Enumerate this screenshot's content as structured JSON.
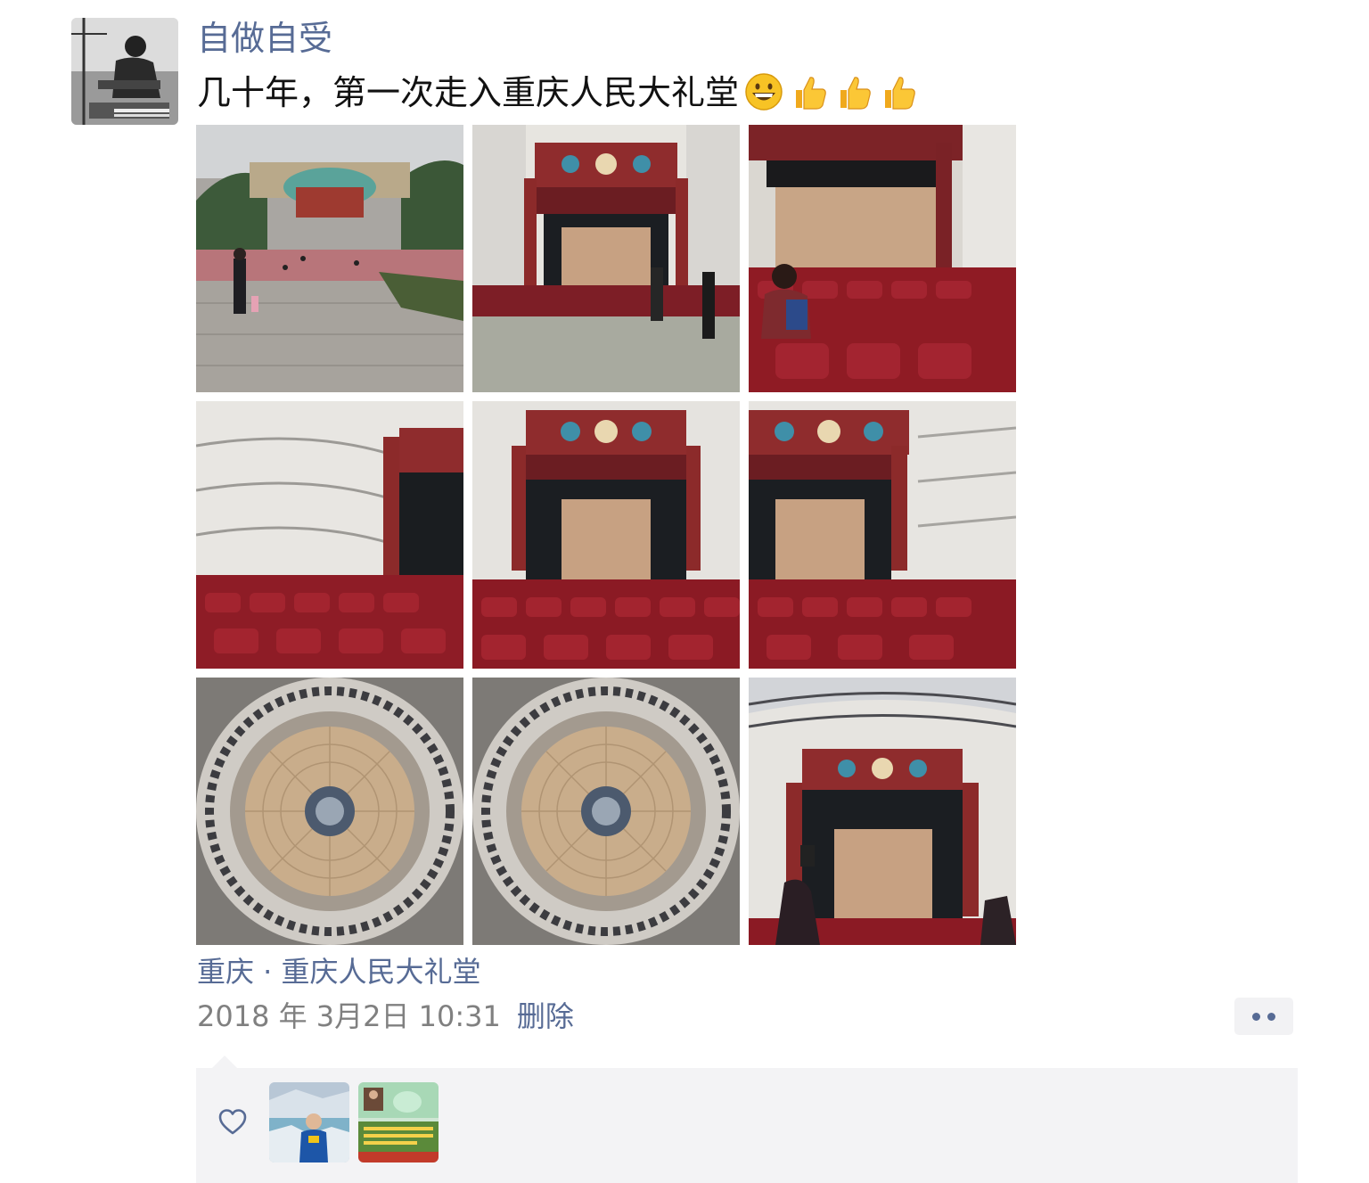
{
  "post": {
    "author": "自做自受",
    "text": "几十年，第一次走入重庆人民大礼堂",
    "emojis": [
      "grinning-face-icon",
      "thumbs-up-icon",
      "thumbs-up-icon",
      "thumbs-up-icon"
    ],
    "photos": [
      {
        "subject": "plaza-and-hall-exterior"
      },
      {
        "subject": "stage-from-floor"
      },
      {
        "subject": "woman-in-seats-stage"
      },
      {
        "subject": "side-balconies-and-stage"
      },
      {
        "subject": "stage-front-view"
      },
      {
        "subject": "stage-front-view-right"
      },
      {
        "subject": "dome-ceiling"
      },
      {
        "subject": "dome-ceiling"
      },
      {
        "subject": "stage-with-photographers"
      }
    ],
    "location": "重庆 · 重庆人民大礼堂",
    "timestamp": "2018 年 3月2日 10:31",
    "delete_label": "删除"
  },
  "likes": {
    "icon": "heart-outline-icon",
    "users": [
      {
        "avatar": "man-in-blue-jacket-glacier"
      },
      {
        "avatar": "green-poster-avatar"
      }
    ]
  },
  "colors": {
    "link": "#576b95",
    "timestamp": "#808080",
    "panel_bg": "#f3f3f5"
  }
}
